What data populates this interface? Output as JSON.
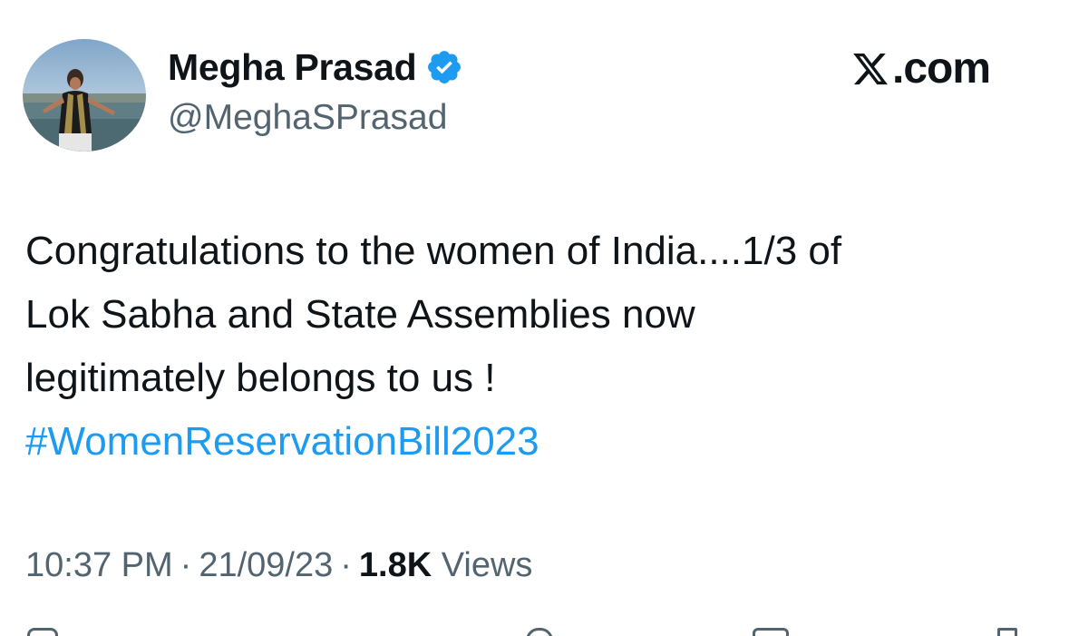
{
  "author": {
    "name": "Megha Prasad",
    "handle": "@MeghaSPrasad",
    "verified": true,
    "avatar_icon": "profile-photo"
  },
  "brand": {
    "label": ".com",
    "icon": "x-logo-icon"
  },
  "tweet": {
    "lines": [
      "Congratulations to the women of India....1/3 of",
      "Lok Sabha and State Assemblies now",
      "legitimately belongs to us !"
    ],
    "hashtag": "#WomenReservationBill2023"
  },
  "meta": {
    "time": "10:37 PM",
    "date": "21/09/23",
    "views_count": "1.8K",
    "views_label": "Views",
    "separator": "·"
  },
  "colors": {
    "text": "#0f1419",
    "secondary": "#536471",
    "link": "#1d9bf0",
    "verified": "#1d9bf0"
  }
}
